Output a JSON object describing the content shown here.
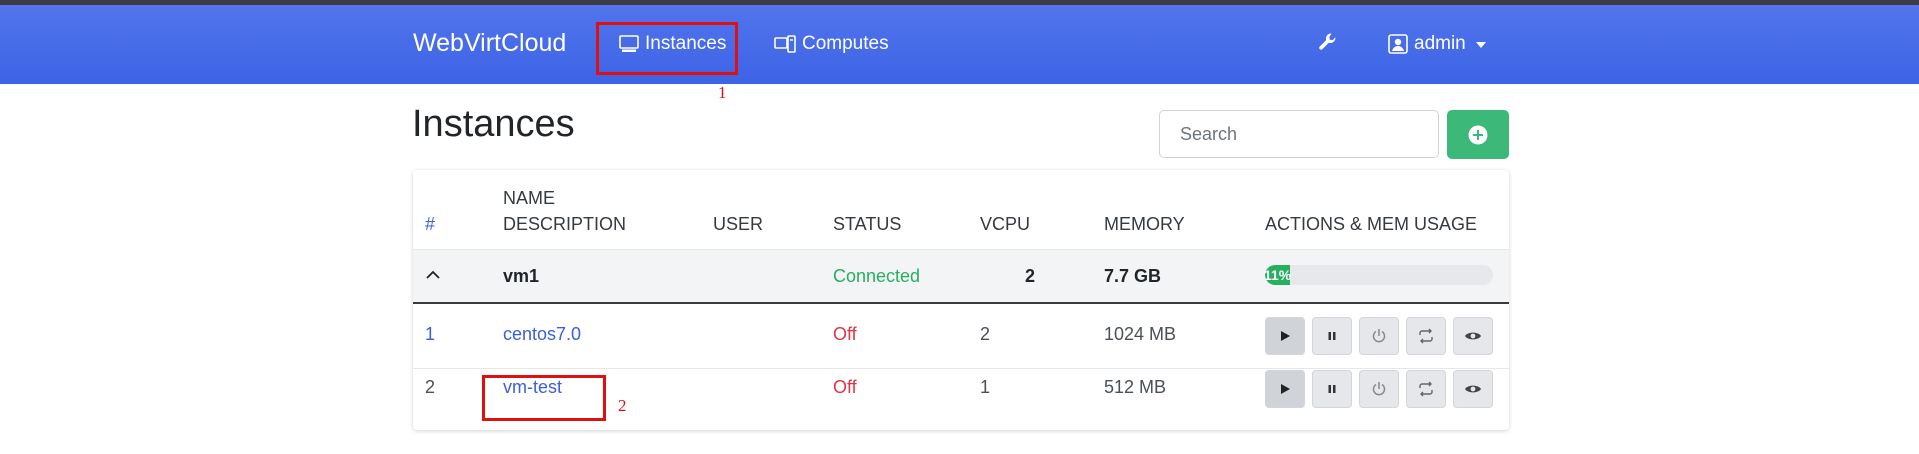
{
  "navbar": {
    "brand": "WebVirtCloud",
    "links": [
      {
        "label": "Instances",
        "icon": "monitor-icon"
      },
      {
        "label": "Computes",
        "icon": "server-icon"
      }
    ],
    "tools_icon": "wrench-icon",
    "user": {
      "label": "admin",
      "icon": "user-icon"
    }
  },
  "annotations": [
    "1",
    "2"
  ],
  "page": {
    "title": "Instances",
    "search_placeholder": "Search",
    "add_icon": "plus-circle-icon"
  },
  "table": {
    "headers": {
      "num": "#",
      "name": "NAME",
      "description": "DESCRIPTION",
      "user": "USER",
      "status": "STATUS",
      "vcpu": "VCPU",
      "memory": "MEMORY",
      "actions": "ACTIONS & MEM USAGE"
    },
    "group": {
      "name": "vm1",
      "status": "Connected",
      "vcpu": "2",
      "memory": "7.7 GB",
      "mem_usage_label": "11%",
      "mem_usage_fraction": 0.11
    },
    "rows": [
      {
        "num": "1",
        "name": "centos7.0",
        "user": "",
        "status": "Off",
        "vcpu": "2",
        "memory": "1024 MB"
      },
      {
        "num": "2",
        "name": "vm-test",
        "user": "",
        "status": "Off",
        "vcpu": "1",
        "memory": "512 MB"
      }
    ],
    "action_icons": [
      "play-icon",
      "pause-icon",
      "power-icon",
      "refresh-icon",
      "eye-icon"
    ]
  },
  "colors": {
    "navbar": "#4268e8",
    "accent_green": "#3cb878",
    "link": "#3a5fd8",
    "status_off": "#dc3545",
    "status_connected": "#27ae60",
    "annotation": "#e01010"
  }
}
